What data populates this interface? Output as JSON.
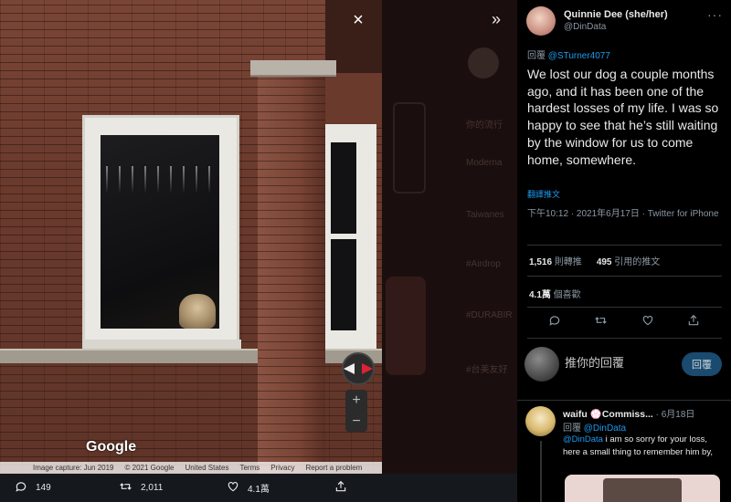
{
  "media": {
    "google_logo": "Google",
    "attribution": [
      "Image capture: Jun 2019",
      "© 2021 Google",
      "United States",
      "Terms",
      "Privacy",
      "Report a problem"
    ],
    "close_icon": "×",
    "collapse_icon": "»",
    "zoom_in": "+",
    "zoom_out": "−",
    "actions": {
      "reply_count": "149",
      "retweet_count": "2,011",
      "like_count": "4.1萬"
    },
    "background_page_fragments": [
      "你的流行",
      "Moderna",
      "Taiwanes",
      "#Airdrop",
      "#DURABIR",
      "#台美友好",
      "訊息"
    ]
  },
  "tweet": {
    "author_name": "Quinnie Dee (she/her)",
    "author_handle": "@DinData",
    "reply_prefix": "回覆",
    "reply_target": "@STurner4077",
    "text": "We lost our dog a couple months ago, and it has been one of the hardest losses of my life. I was so happy to see that he’s still waiting by the window for us to come home, somewhere.",
    "translate": "翻譯推文",
    "meta": "下午10:12 · 2021年6月17日 · Twitter for iPhone",
    "retweets_value": "1,516",
    "retweets_label": "則轉推",
    "quotes_value": "495",
    "quotes_label": "引用的推文",
    "likes_value": "4.1萬",
    "likes_label": "個喜歡",
    "reply_placeholder": "推你的回覆",
    "reply_button": "回覆"
  },
  "reply": {
    "author_name": "waifu 💮Commiss...",
    "date": "· 6月18日",
    "reply_prefix": "回覆",
    "reply_target": "@DinData",
    "mention": "@DinData",
    "text": " i am so sorry for your loss, here a small thing to remember him by,"
  },
  "colors": {
    "accent": "#1d9bf0",
    "background": "#000000",
    "text_primary": "#e7e9ea",
    "text_secondary": "#8b98a5"
  },
  "icons": {
    "reply": "comment-icon",
    "retweet": "retweet-icon",
    "like": "heart-icon",
    "share": "share-icon",
    "close": "close-icon",
    "collapse": "chevron-double-right-icon"
  }
}
